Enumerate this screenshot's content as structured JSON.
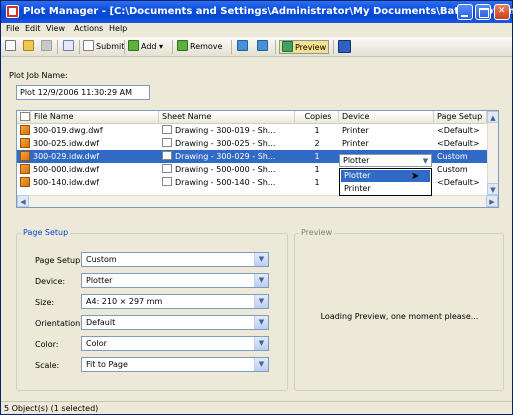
{
  "window": {
    "title": "Plot Manager - [C:\\Documents and Settings\\Administrator\\My Documents\\Batch Plot.xml]"
  },
  "menu": [
    "File",
    "Edit",
    "View",
    "Actions",
    "Help"
  ],
  "toolbar": {
    "submit_label": "Submit",
    "add_label": "Add",
    "remove_label": "Remove",
    "preview_label": "Preview"
  },
  "job": {
    "label": "Plot Job Name:",
    "value": "Plot 12/9/2006 11:30:29 AM"
  },
  "list": {
    "columns": [
      "File Name",
      "Sheet Name",
      "Copies",
      "Device",
      "Page Setup"
    ],
    "rows": [
      {
        "file": "300-019.dwg.dwf",
        "sheet": "Drawing - 300-019 - Sh...",
        "copies": "1",
        "device": "Printer",
        "setup": "<Default>"
      },
      {
        "file": "300-025.idw.dwf",
        "sheet": "Drawing - 300-025 - Sh...",
        "copies": "2",
        "device": "Printer",
        "setup": "<Default>"
      },
      {
        "file": "300-029.idw.dwf",
        "sheet": "Drawing - 300-029 - Sh...",
        "copies": "1",
        "device": "Plotter",
        "setup": "Custom"
      },
      {
        "file": "500-000.idw.dwf",
        "sheet": "Drawing - 500-000 - Sh...",
        "copies": "1",
        "device": "Plotter",
        "setup": "Custom"
      },
      {
        "file": "500-140.idw.dwf",
        "sheet": "Drawing - 500-140 - Sh...",
        "copies": "1",
        "device": "",
        "setup": "<Default>"
      }
    ],
    "device_options": [
      "Plotter",
      "Printer"
    ]
  },
  "page_setup": {
    "title": "Page Setup",
    "fields": [
      {
        "label": "Page Setup:",
        "value": "Custom"
      },
      {
        "label": "Device:",
        "value": "Plotter"
      },
      {
        "label": "Size:",
        "value": "A4: 210 × 297 mm"
      },
      {
        "label": "Orientation:",
        "value": "Default"
      },
      {
        "label": "Color:",
        "value": "Color"
      },
      {
        "label": "Scale:",
        "value": "Fit to Page"
      }
    ]
  },
  "preview": {
    "title": "Preview",
    "message": "Loading Preview, one moment please..."
  },
  "status": "5 Object(s) (1 selected)",
  "colors": {
    "titlebar": "#0a4ede",
    "selection": "#316ac5",
    "group_title": "#0046d5"
  }
}
